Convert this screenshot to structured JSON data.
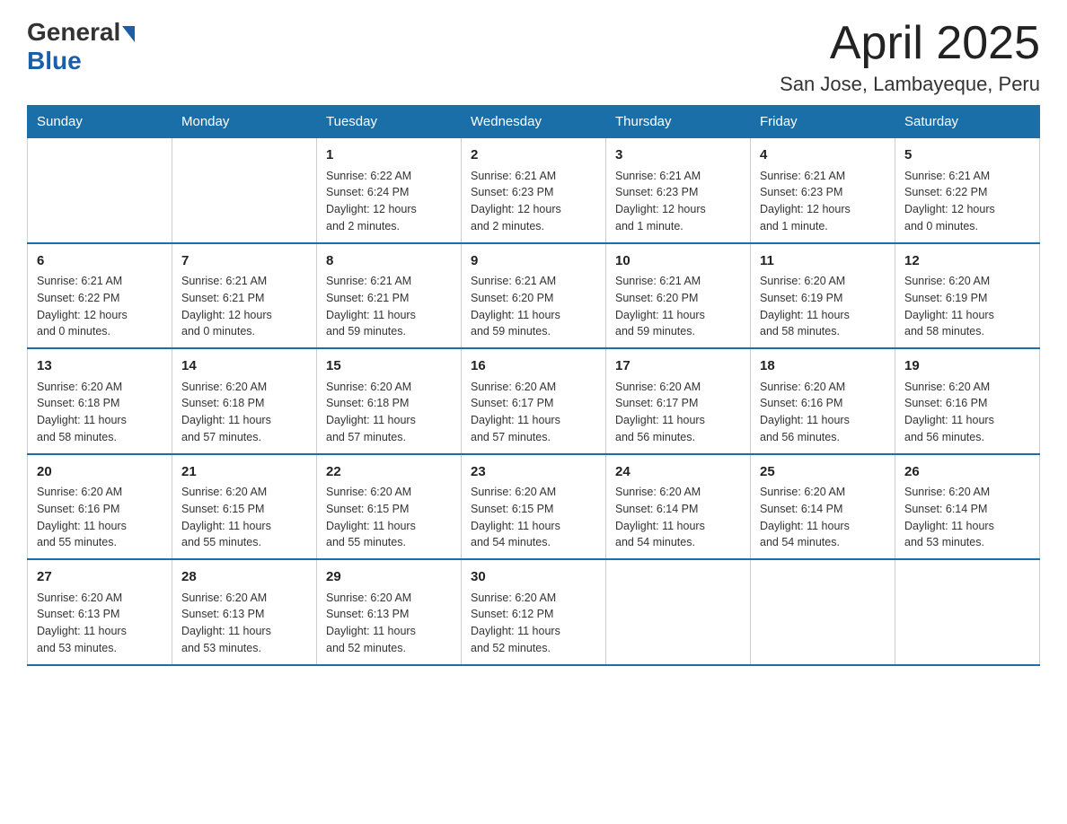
{
  "header": {
    "logo_general": "General",
    "logo_blue": "Blue",
    "month_year": "April 2025",
    "location": "San Jose, Lambayeque, Peru"
  },
  "weekdays": [
    "Sunday",
    "Monday",
    "Tuesday",
    "Wednesday",
    "Thursday",
    "Friday",
    "Saturday"
  ],
  "weeks": [
    [
      {
        "day": "",
        "info": ""
      },
      {
        "day": "",
        "info": ""
      },
      {
        "day": "1",
        "info": "Sunrise: 6:22 AM\nSunset: 6:24 PM\nDaylight: 12 hours\nand 2 minutes."
      },
      {
        "day": "2",
        "info": "Sunrise: 6:21 AM\nSunset: 6:23 PM\nDaylight: 12 hours\nand 2 minutes."
      },
      {
        "day": "3",
        "info": "Sunrise: 6:21 AM\nSunset: 6:23 PM\nDaylight: 12 hours\nand 1 minute."
      },
      {
        "day": "4",
        "info": "Sunrise: 6:21 AM\nSunset: 6:23 PM\nDaylight: 12 hours\nand 1 minute."
      },
      {
        "day": "5",
        "info": "Sunrise: 6:21 AM\nSunset: 6:22 PM\nDaylight: 12 hours\nand 0 minutes."
      }
    ],
    [
      {
        "day": "6",
        "info": "Sunrise: 6:21 AM\nSunset: 6:22 PM\nDaylight: 12 hours\nand 0 minutes."
      },
      {
        "day": "7",
        "info": "Sunrise: 6:21 AM\nSunset: 6:21 PM\nDaylight: 12 hours\nand 0 minutes."
      },
      {
        "day": "8",
        "info": "Sunrise: 6:21 AM\nSunset: 6:21 PM\nDaylight: 11 hours\nand 59 minutes."
      },
      {
        "day": "9",
        "info": "Sunrise: 6:21 AM\nSunset: 6:20 PM\nDaylight: 11 hours\nand 59 minutes."
      },
      {
        "day": "10",
        "info": "Sunrise: 6:21 AM\nSunset: 6:20 PM\nDaylight: 11 hours\nand 59 minutes."
      },
      {
        "day": "11",
        "info": "Sunrise: 6:20 AM\nSunset: 6:19 PM\nDaylight: 11 hours\nand 58 minutes."
      },
      {
        "day": "12",
        "info": "Sunrise: 6:20 AM\nSunset: 6:19 PM\nDaylight: 11 hours\nand 58 minutes."
      }
    ],
    [
      {
        "day": "13",
        "info": "Sunrise: 6:20 AM\nSunset: 6:18 PM\nDaylight: 11 hours\nand 58 minutes."
      },
      {
        "day": "14",
        "info": "Sunrise: 6:20 AM\nSunset: 6:18 PM\nDaylight: 11 hours\nand 57 minutes."
      },
      {
        "day": "15",
        "info": "Sunrise: 6:20 AM\nSunset: 6:18 PM\nDaylight: 11 hours\nand 57 minutes."
      },
      {
        "day": "16",
        "info": "Sunrise: 6:20 AM\nSunset: 6:17 PM\nDaylight: 11 hours\nand 57 minutes."
      },
      {
        "day": "17",
        "info": "Sunrise: 6:20 AM\nSunset: 6:17 PM\nDaylight: 11 hours\nand 56 minutes."
      },
      {
        "day": "18",
        "info": "Sunrise: 6:20 AM\nSunset: 6:16 PM\nDaylight: 11 hours\nand 56 minutes."
      },
      {
        "day": "19",
        "info": "Sunrise: 6:20 AM\nSunset: 6:16 PM\nDaylight: 11 hours\nand 56 minutes."
      }
    ],
    [
      {
        "day": "20",
        "info": "Sunrise: 6:20 AM\nSunset: 6:16 PM\nDaylight: 11 hours\nand 55 minutes."
      },
      {
        "day": "21",
        "info": "Sunrise: 6:20 AM\nSunset: 6:15 PM\nDaylight: 11 hours\nand 55 minutes."
      },
      {
        "day": "22",
        "info": "Sunrise: 6:20 AM\nSunset: 6:15 PM\nDaylight: 11 hours\nand 55 minutes."
      },
      {
        "day": "23",
        "info": "Sunrise: 6:20 AM\nSunset: 6:15 PM\nDaylight: 11 hours\nand 54 minutes."
      },
      {
        "day": "24",
        "info": "Sunrise: 6:20 AM\nSunset: 6:14 PM\nDaylight: 11 hours\nand 54 minutes."
      },
      {
        "day": "25",
        "info": "Sunrise: 6:20 AM\nSunset: 6:14 PM\nDaylight: 11 hours\nand 54 minutes."
      },
      {
        "day": "26",
        "info": "Sunrise: 6:20 AM\nSunset: 6:14 PM\nDaylight: 11 hours\nand 53 minutes."
      }
    ],
    [
      {
        "day": "27",
        "info": "Sunrise: 6:20 AM\nSunset: 6:13 PM\nDaylight: 11 hours\nand 53 minutes."
      },
      {
        "day": "28",
        "info": "Sunrise: 6:20 AM\nSunset: 6:13 PM\nDaylight: 11 hours\nand 53 minutes."
      },
      {
        "day": "29",
        "info": "Sunrise: 6:20 AM\nSunset: 6:13 PM\nDaylight: 11 hours\nand 52 minutes."
      },
      {
        "day": "30",
        "info": "Sunrise: 6:20 AM\nSunset: 6:12 PM\nDaylight: 11 hours\nand 52 minutes."
      },
      {
        "day": "",
        "info": ""
      },
      {
        "day": "",
        "info": ""
      },
      {
        "day": "",
        "info": ""
      }
    ]
  ]
}
